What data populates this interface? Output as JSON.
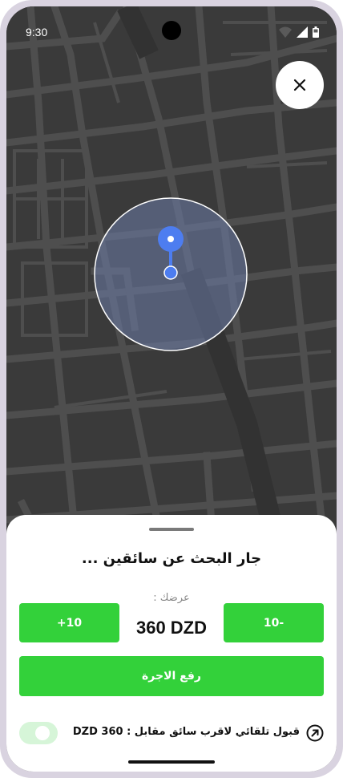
{
  "status_bar": {
    "time": "9:30"
  },
  "map": {
    "background": "#3a3a3a",
    "roads": "#4e4e4e",
    "search_radius_fill": "#6b7ba8",
    "pin_color": "#4d7df0"
  },
  "sheet": {
    "title": "جار البحث عن سائقين ...",
    "offer_label": "عرضك :",
    "decrease_label": "10-",
    "increase_label": "+10",
    "price": "360 DZD",
    "raise_fare_label": "رفع الاجرة",
    "auto_accept_text": "قبول تلقائي لاقرب سائق مقابل : 360 DZD",
    "accent": "#33d13a"
  },
  "icons": [
    "close-icon",
    "location-pin-icon",
    "wifi-icon",
    "signal-icon",
    "battery-icon",
    "arrow-up-right-icon"
  ]
}
